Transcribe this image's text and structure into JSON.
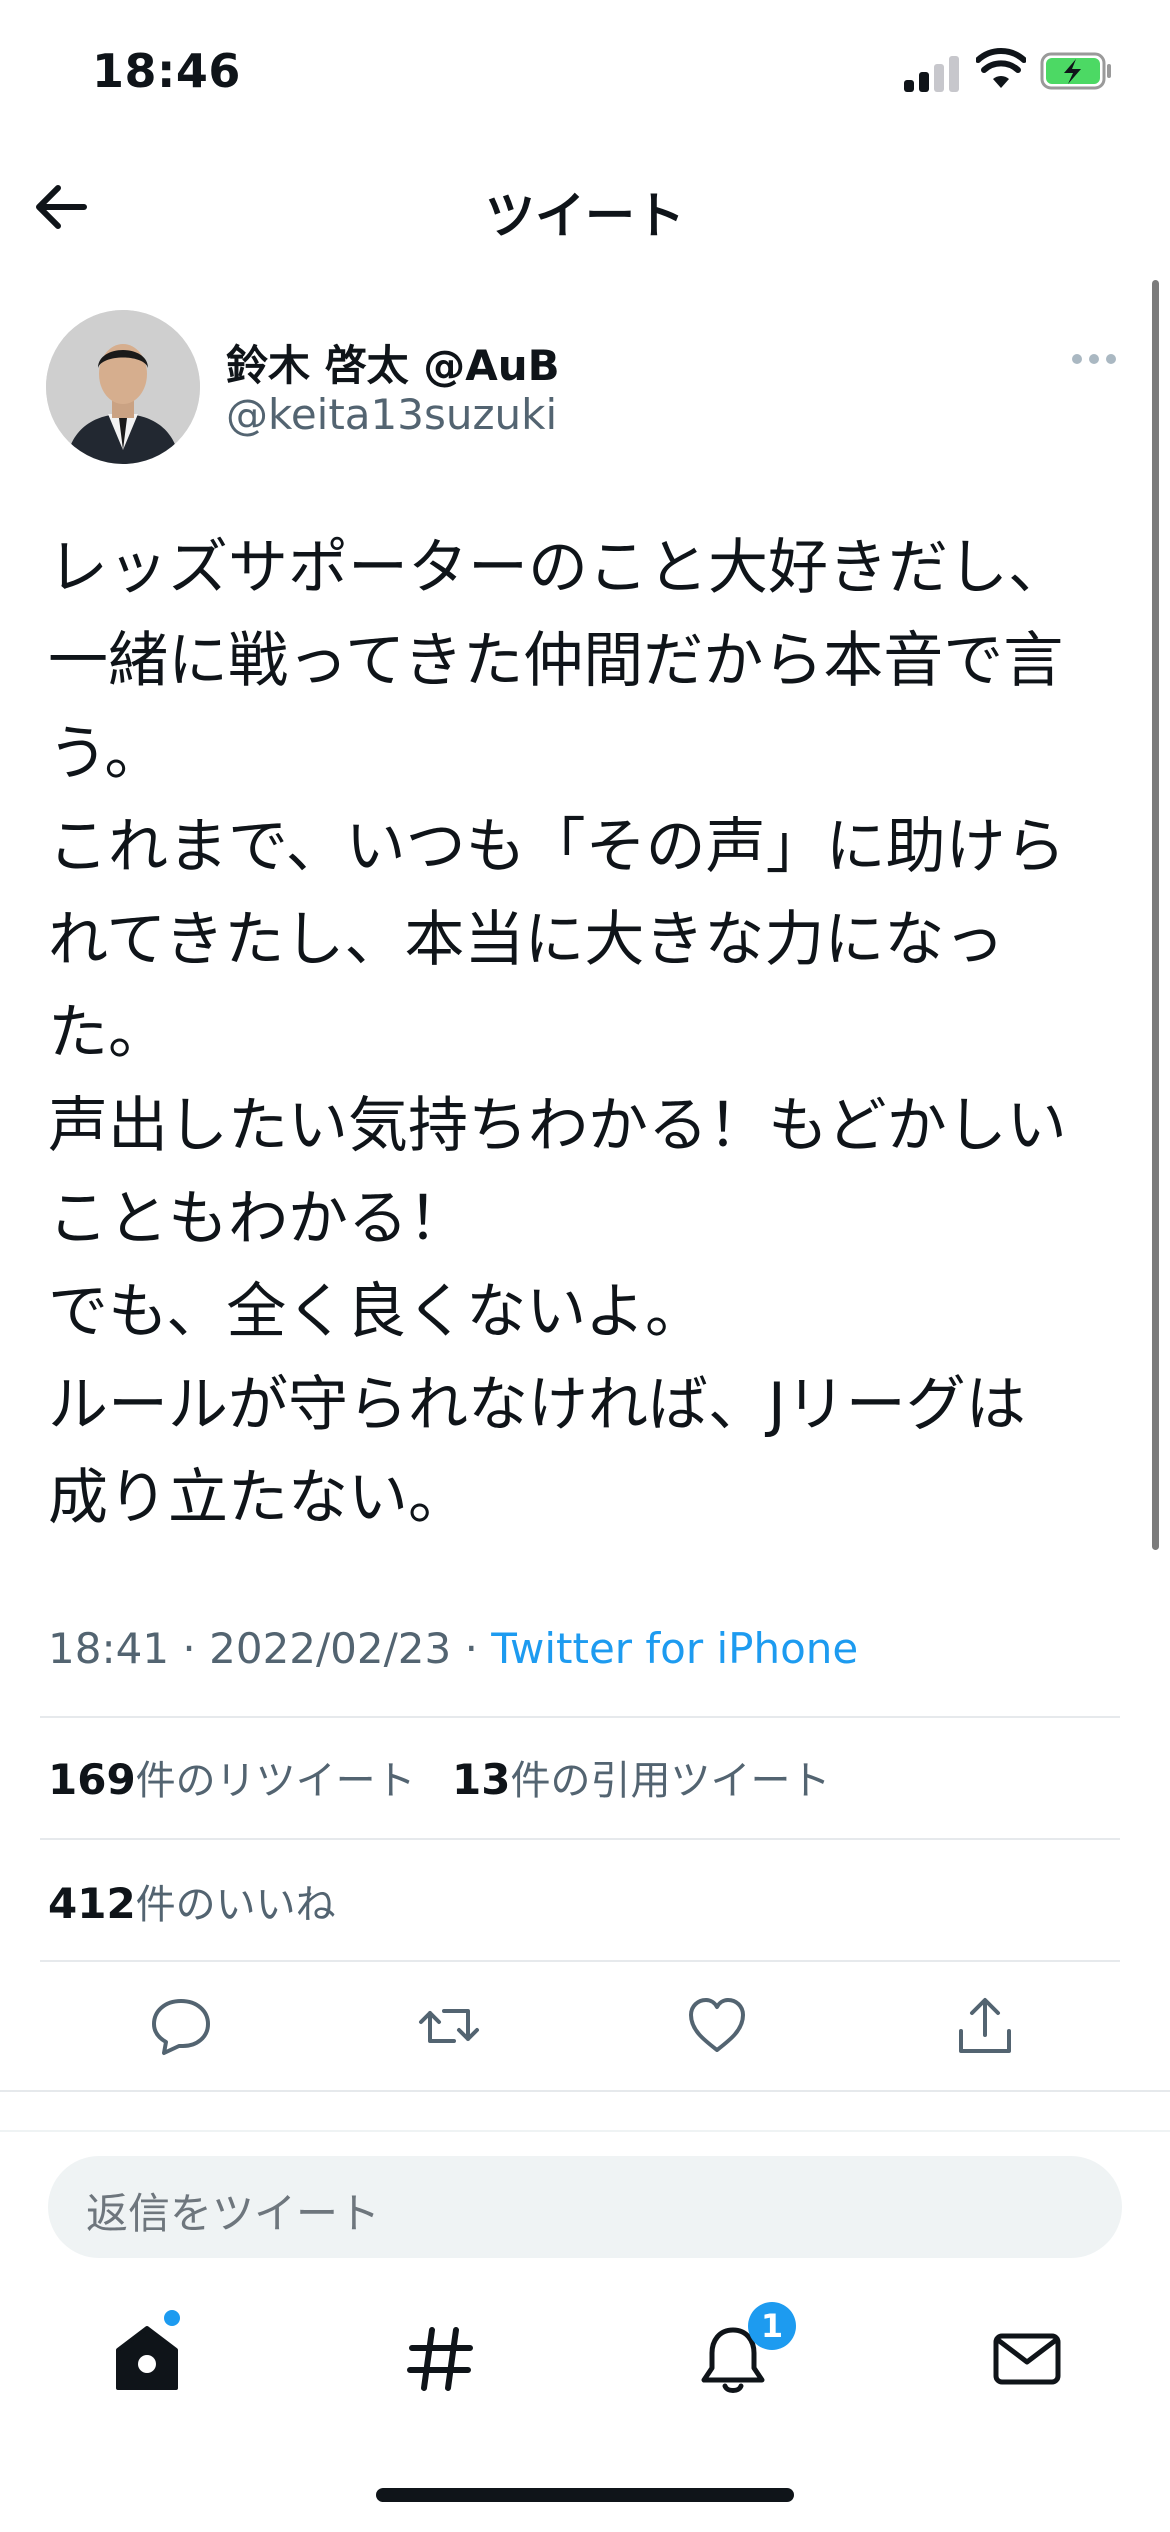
{
  "status_bar": {
    "time": "18:46"
  },
  "header": {
    "title": "ツイート",
    "back_icon": "arrow-left-icon"
  },
  "tweet": {
    "author_name": "鈴木 啓太 @AuB",
    "author_handle": "@keita13suzuki",
    "text_lines": [
      "レッズサポーターのこと大好きだし、",
      "一緒に戦ってきた仲間だから本音で言",
      "う。",
      "これまで、いつも「その声」に助けら",
      "れてきたし、本当に大きな力になっ",
      "た。",
      "声出したい気持ちわかる！もどかしい",
      "こともわかる！",
      "でも、全く良くないよ。",
      "ルールが守られなければ、Jリーグは",
      "成り立たない。"
    ],
    "time": "18:41",
    "date": "2022/02/23",
    "source": "Twitter for iPhone",
    "separator": "·"
  },
  "stats": {
    "retweets_count": "169",
    "retweets_label": "件のリツイート",
    "quotes_count": "13",
    "quotes_label": "件の引用ツイート",
    "likes_count": "412",
    "likes_label": "件のいいね"
  },
  "actions": [
    "reply-icon",
    "retweet-icon",
    "like-icon",
    "share-icon"
  ],
  "reply": {
    "placeholder": "返信をツイート"
  },
  "tab_bar": {
    "items": [
      "home-icon",
      "explore-hashtag-icon",
      "notifications-icon",
      "messages-icon"
    ],
    "notifications_badge": "1"
  },
  "colors": {
    "accent": "#1d9bf0",
    "text": "#0f1419",
    "secondary": "#536471"
  }
}
